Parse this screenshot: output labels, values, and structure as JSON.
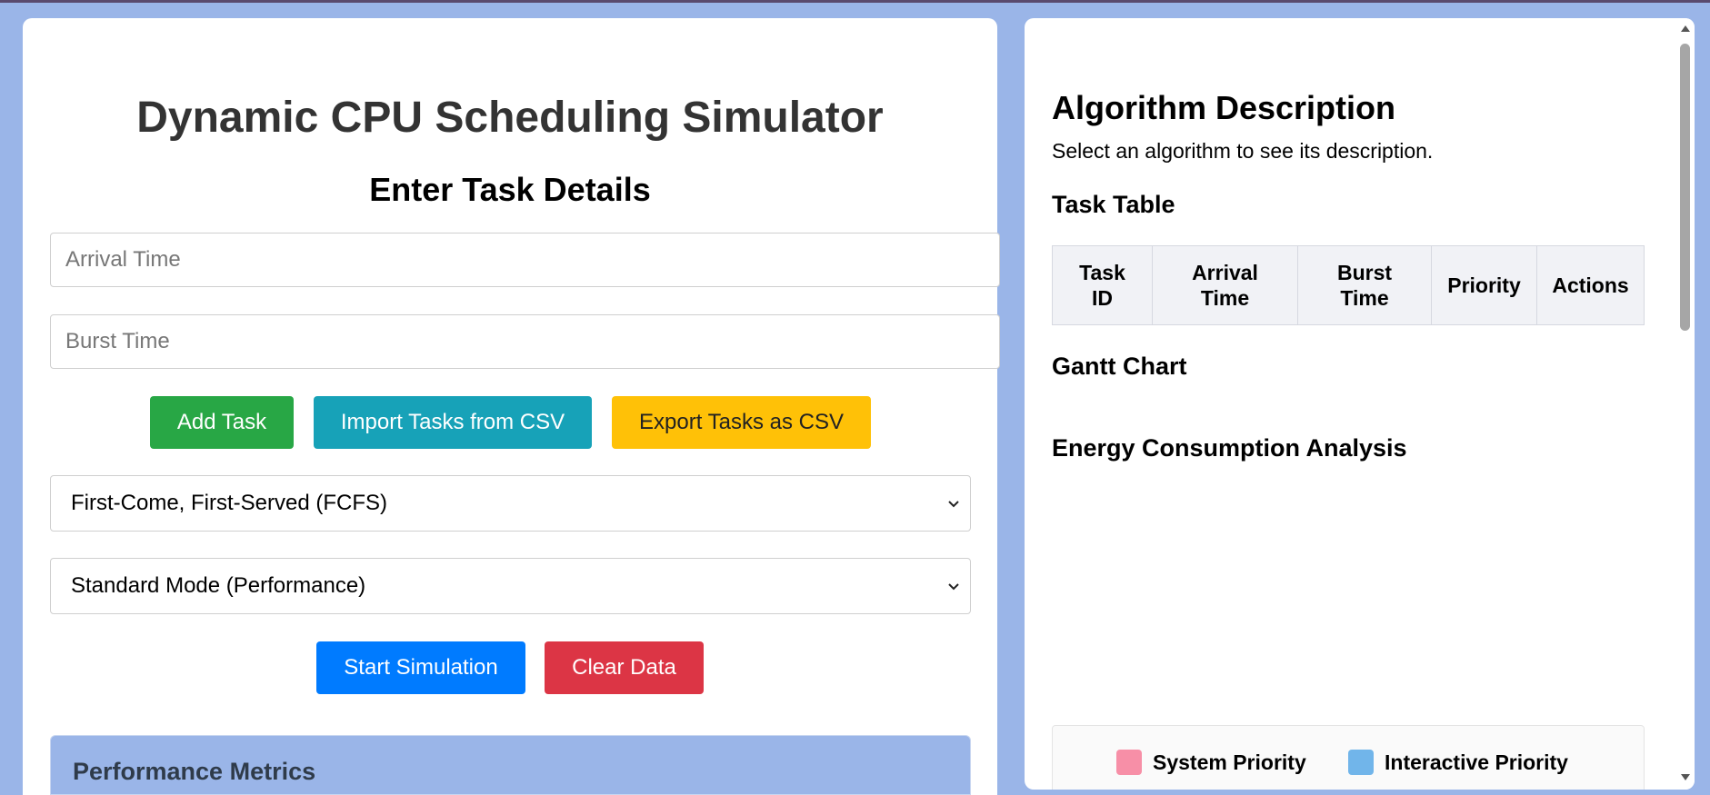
{
  "app": {
    "title": "Dynamic CPU Scheduling Simulator",
    "subtitle": "Enter Task Details"
  },
  "form": {
    "arrival_placeholder": "Arrival Time",
    "arrival_value": "",
    "burst_placeholder": "Burst Time",
    "burst_value": ""
  },
  "buttons": {
    "add_task": "Add Task",
    "import_csv": "Import Tasks from CSV",
    "export_csv": "Export Tasks as CSV",
    "start_simulation": "Start Simulation",
    "clear_data": "Clear Data"
  },
  "selects": {
    "algorithm": "First-Come, First-Served (FCFS)",
    "mode": "Standard Mode (Performance)"
  },
  "metrics": {
    "title": "Performance Metrics"
  },
  "right": {
    "algo_heading": "Algorithm Description",
    "algo_desc": "Select an algorithm to see its description.",
    "task_table_heading": "Task Table",
    "task_table_columns": [
      [
        "Task",
        "ID"
      ],
      [
        "Arrival",
        "Time"
      ],
      [
        "Burst",
        "Time"
      ],
      [
        "Priority",
        ""
      ],
      [
        "Actions",
        ""
      ]
    ],
    "gantt_heading": "Gantt Chart",
    "energy_heading": "Energy Consumption Analysis",
    "legend": [
      {
        "label": "System Priority",
        "color": "#f78fa7"
      },
      {
        "label": "Interactive Priority",
        "color": "#71b5ea"
      }
    ]
  },
  "colors": {
    "background": "#9ab5e8",
    "add": "#28a745",
    "import": "#17a2b8",
    "export": "#ffc107",
    "start": "#007bff",
    "clear": "#dc3545"
  },
  "icons": {
    "select_chevron": "chevron-down-icon",
    "scroll_up": "scroll-up-arrow-icon",
    "scroll_down": "scroll-down-arrow-icon"
  }
}
